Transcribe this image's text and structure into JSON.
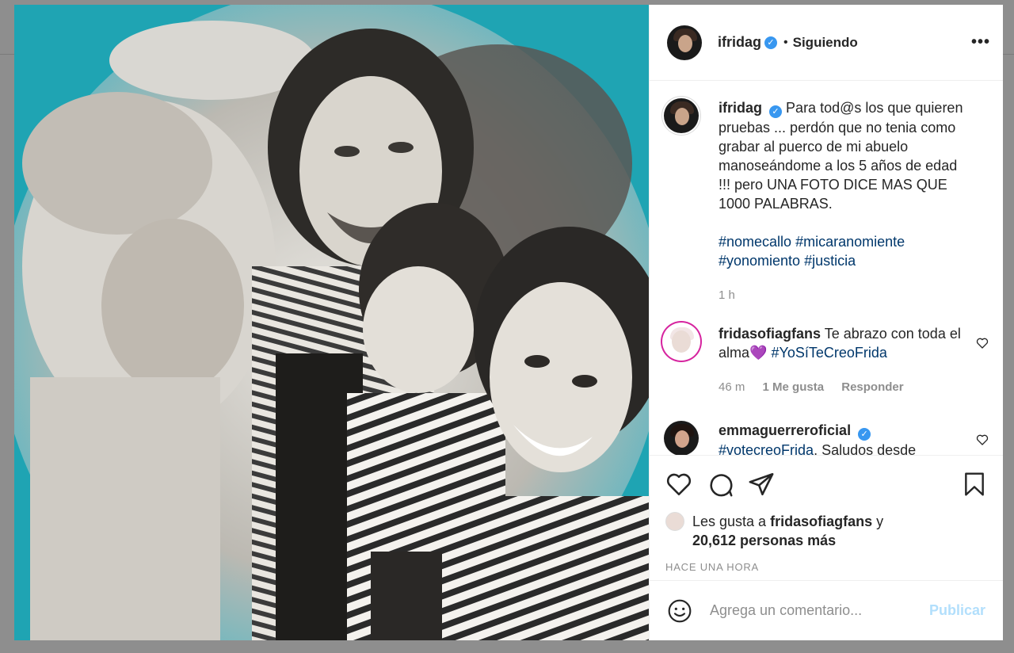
{
  "post": {
    "username": "ifridag",
    "verified_mark": "✓",
    "separator": "•",
    "follow_status": "Siguiendo",
    "more_label": "•••",
    "photo_icon": "family-photo",
    "caption": {
      "username": "ifridag",
      "text": "Para tod@s los que quieren pruebas ... perdón que no tenia como grabar al puerco de mi abuelo manoseándome a los 5 años de edad !!! pero UNA FOTO DICE MAS QUE 1000 PALABRAS.",
      "hashtags": [
        "#nomecallo",
        "#micaranomiente",
        "#yonomiento",
        "#justicia"
      ],
      "time": "1 h"
    },
    "comments": [
      {
        "username": "fridasofiagfans",
        "text": "Te abrazo con toda el alma",
        "emoji": "💜",
        "hashtag": "#YoSíTeCreoFrida",
        "time": "46 m",
        "likes": "1 Me gusta",
        "reply": "Responder"
      },
      {
        "username": "emmaguerreroficial",
        "hashtag": "#votecreoFrida",
        "text": ". Saludos desde"
      }
    ],
    "liked_by": {
      "prefix": "Les gusta a",
      "user": "fridasofiagfans",
      "conj": "y",
      "count": "20,612 personas más"
    },
    "timestamp": "HACE UNA HORA",
    "comment_input": {
      "placeholder": "Agrega un comentario...",
      "submit": "Publicar"
    }
  },
  "colors": {
    "photo_bg": "#1fa4b3",
    "link": "#00376b",
    "verified": "#3897f0",
    "muted": "#8e8e8e",
    "publish_disabled": "#b2dffc"
  },
  "icons": [
    "heart-icon",
    "comment-icon",
    "share-icon",
    "bookmark-icon",
    "emoji-icon",
    "more-icon",
    "verified-icon"
  ]
}
